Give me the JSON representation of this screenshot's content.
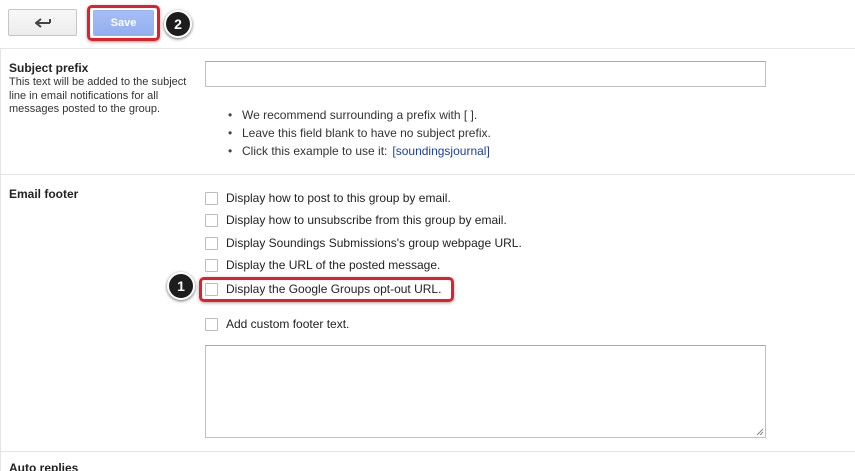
{
  "toolbar": {
    "back_icon": "back-arrow-icon",
    "back_glyph": "⟵",
    "save_label": "Save"
  },
  "annotations": {
    "badge_save": "2",
    "badge_optout": "1",
    "highlight_color": "#e0202a"
  },
  "subject_prefix": {
    "title": "Subject prefix",
    "description": "This text will be added to the subject line in email notifications for all messages posted to the group.",
    "input_value": "",
    "tips": [
      {
        "text": "We recommend surrounding a prefix with [ ]."
      },
      {
        "text": "Leave this field blank to have no subject prefix."
      },
      {
        "text": "Click this example to use it:",
        "link": "[soundingsjournal]"
      }
    ]
  },
  "email_footer": {
    "title": "Email footer",
    "options": [
      {
        "label": "Display how to post to this group by email.",
        "checked": false
      },
      {
        "label": "Display how to unsubscribe from this group by email.",
        "checked": false
      },
      {
        "label": "Display Soundings Submissions's group webpage URL.",
        "checked": false
      },
      {
        "label": "Display the URL of the posted message.",
        "checked": false
      },
      {
        "label": "Display the Google Groups opt-out URL.",
        "checked": false
      },
      {
        "label": "Add custom footer text.",
        "checked": false
      }
    ],
    "custom_text_value": ""
  },
  "auto_replies": {
    "title": "Auto replies"
  },
  "colors": {
    "save_button": "#9db7f3",
    "link": "#1a3fa6"
  }
}
